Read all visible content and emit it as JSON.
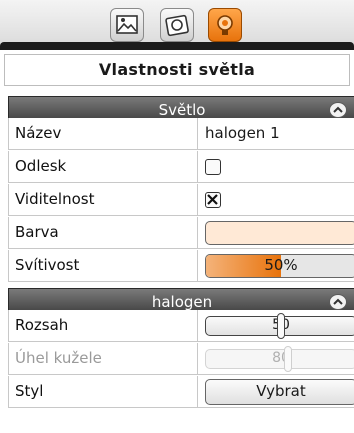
{
  "tabs": [
    {
      "icon": "image-icon",
      "active": false
    },
    {
      "icon": "material-icon",
      "active": false
    },
    {
      "icon": "light-icon",
      "active": true
    }
  ],
  "panel": {
    "title": "Vlastnosti světla"
  },
  "sections": [
    {
      "title": "Světlo",
      "collapse_icon": "chevron-up-icon",
      "rows": {
        "name": {
          "label": "Název",
          "value": "halogen 1"
        },
        "specular": {
          "label": "Odlesk",
          "checked": false
        },
        "visibility": {
          "label": "Viditelnost",
          "checked": true
        },
        "color": {
          "label": "Barva",
          "value": "#ffe9d6"
        },
        "intensity": {
          "label": "Svítivost",
          "value": "50%",
          "fraction": 0.5
        }
      }
    },
    {
      "title": "halogen",
      "collapse_icon": "chevron-up-icon",
      "rows": {
        "range": {
          "label": "Rozsah",
          "value": "50",
          "fraction": 0.5
        },
        "cone_angle": {
          "label": "Úhel kužele",
          "value": "80",
          "fraction": 0.55,
          "disabled": true
        },
        "style": {
          "label": "Styl",
          "button_label": "Vybrat"
        }
      }
    }
  ],
  "colors": {
    "accent": "#e8730c",
    "header_bg": "#4a4a4a"
  }
}
